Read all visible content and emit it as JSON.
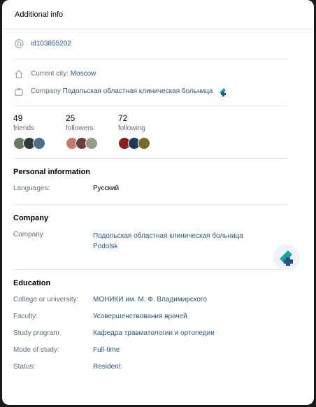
{
  "header": {
    "title": "Additional info"
  },
  "contact": {
    "id_link": "id103855202"
  },
  "location": {
    "city_label": "Current city:",
    "city_value": "Moscow",
    "company_label": "Company",
    "company_value": "Подольская областная клиническая больница"
  },
  "stats": [
    {
      "count": "49",
      "label": "friends"
    },
    {
      "count": "25",
      "label": "followers"
    },
    {
      "count": "72",
      "label": "following"
    }
  ],
  "personal": {
    "title": "Personal information",
    "languages_label": "Languages:",
    "languages_value": "Русский"
  },
  "company": {
    "title": "Company",
    "label": "Company",
    "name": "Подольская областная клиническая больница",
    "city": "Podolsk"
  },
  "education": {
    "title": "Education",
    "rows": [
      {
        "label": "College or university:",
        "value": "МОНИКИ им. М. Ф. Владимирского"
      },
      {
        "label": "Faculty:",
        "value": "Усовершенствования врачей"
      },
      {
        "label": "Study program:",
        "value": "Кафедра травматологии и ортопедии"
      },
      {
        "label": "Mode of study:",
        "value": "Full-time"
      },
      {
        "label": "Status:",
        "value": "Resident"
      }
    ]
  },
  "colors": {
    "link": "#2a5885",
    "muted": "#626d7a",
    "logo_teal": "#1aa3a0",
    "logo_blue": "#2a4f8f"
  }
}
